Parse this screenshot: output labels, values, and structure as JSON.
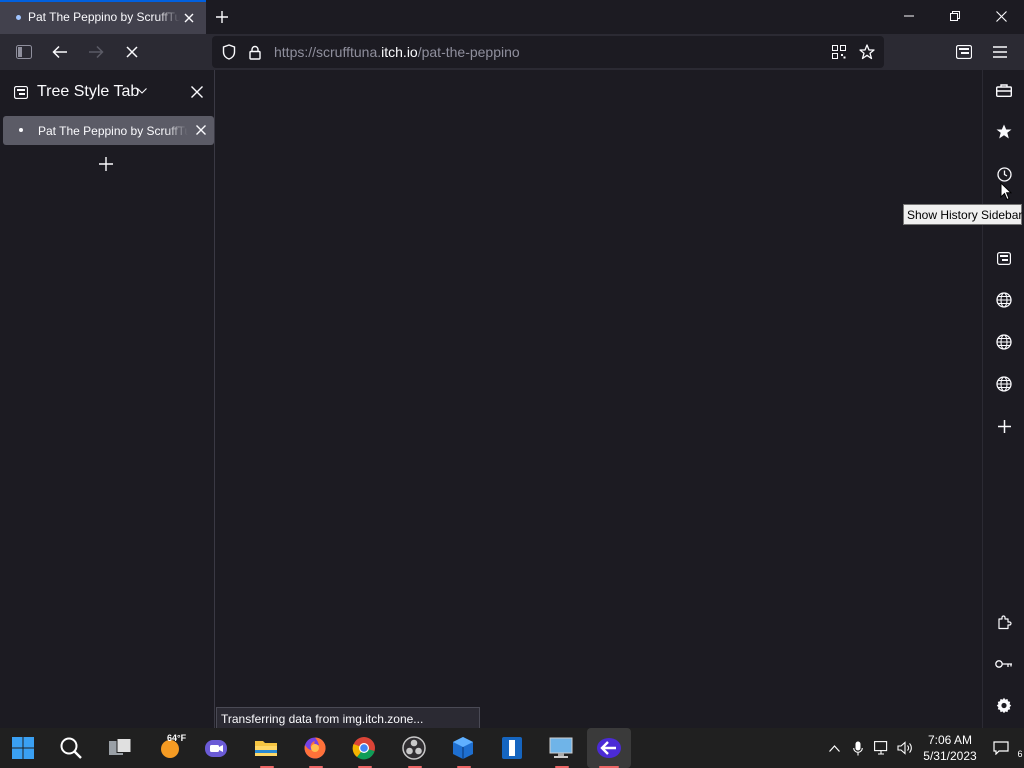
{
  "window": {
    "active_tab_title": "Pat The Peppino by ScruffTuna",
    "new_tab_label": "+"
  },
  "navbar": {
    "url_prefix": "https://scrufftuna.",
    "url_domain": "itch.io",
    "url_path": "/pat-the-peppino"
  },
  "sidebar": {
    "title": "Tree Style Tab",
    "tabs": [
      {
        "label": "Pat The Peppino by ScruffTuna"
      }
    ]
  },
  "status": {
    "text": "Transferring data from img.itch.zone..."
  },
  "right_strip": {
    "items": [
      "briefcase-icon",
      "bookmark-star-icon",
      "history-icon",
      "sidebar-panel-icon",
      "globe-icon",
      "globe-icon",
      "globe-icon",
      "add-icon",
      "extensions-icon",
      "key-icon",
      "settings-icon"
    ],
    "tooltip": "Show History Sidebar"
  },
  "taskbar": {
    "weather_temp": "64°F",
    "time": "7:06 AM",
    "date": "5/31/2023",
    "notification_count": "6"
  },
  "colors": {
    "accent": "#0060df",
    "background": "#1c1b22",
    "toolbar": "#2b2a33",
    "taskbar": "#202020"
  }
}
